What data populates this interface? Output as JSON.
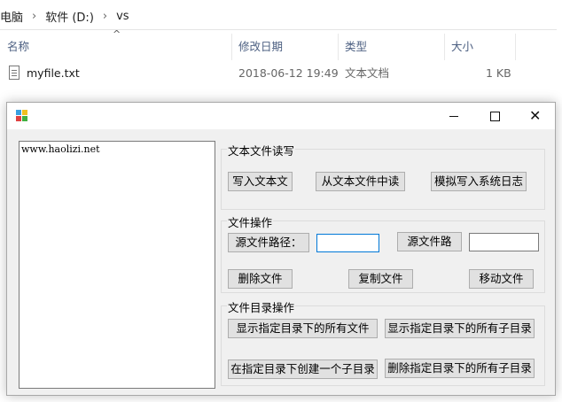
{
  "explorer": {
    "breadcrumb": [
      "电脑",
      "软件 (D:)",
      "vs"
    ],
    "breadcrumb_sep": "›",
    "columns": [
      "名称",
      "修改日期",
      "类型",
      "大小"
    ],
    "sort_glyph": "^",
    "file": {
      "name": "myfile.txt",
      "modified": "2018-06-12 19:49",
      "type": "文本文档",
      "size": "1 KB",
      "icon": "text-file-icon"
    }
  },
  "window": {
    "title": "",
    "close_glyph": "✕",
    "textbox_content": "www.haolizi.net",
    "group_text": {
      "title": "文本文件读写",
      "buttons": [
        "写入文本文",
        "从文本文件中读",
        "模拟写入系统日志"
      ]
    },
    "group_file": {
      "title": "文件操作",
      "source_path_button": "源文件路径：",
      "source_path_value": "",
      "dest_path_button": "源文件路",
      "dest_path_value": "",
      "delete_button": "删除文件",
      "copy_button": "复制文件",
      "move_button": "移动文件"
    },
    "group_dir": {
      "title": "文件目录操作",
      "buttons": [
        "显示指定目录下的所有文件",
        "显示指定目录下的所有子目录",
        "在指定目录下创建一个子目录",
        "删除指定目录下的所有子目录"
      ]
    }
  }
}
